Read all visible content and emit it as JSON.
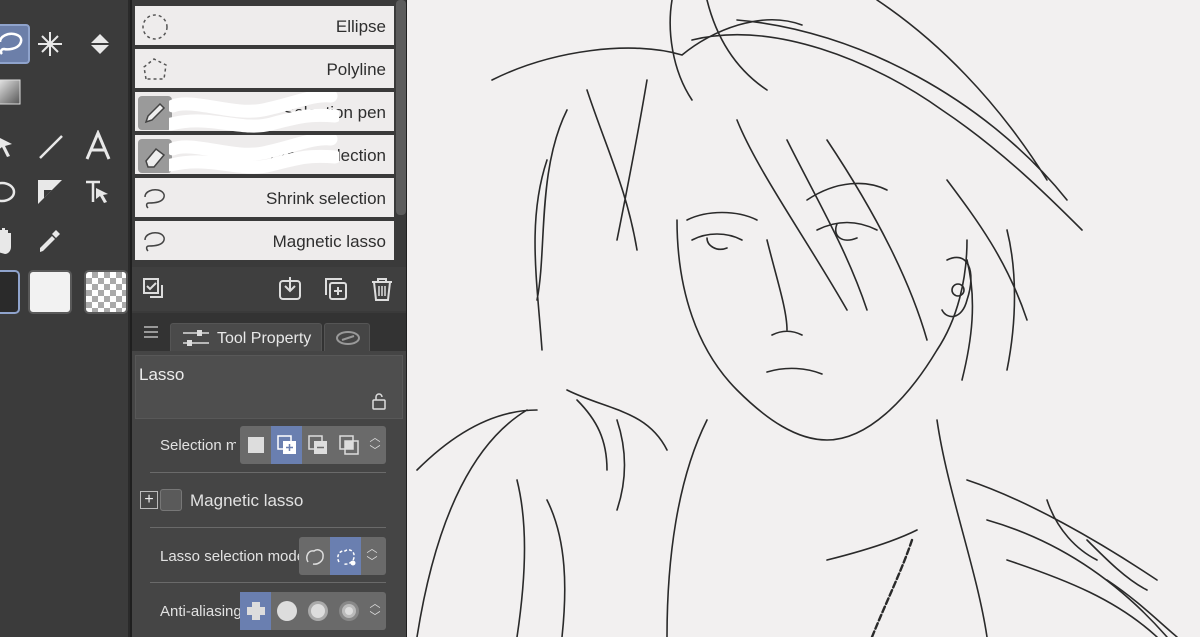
{
  "toolbox": {
    "tools": [
      "selection-lasso",
      "auto-select",
      "fill",
      "gradient",
      "operation",
      "line",
      "text",
      "ellipse-figure",
      "ruler",
      "object",
      "hand",
      "eyedropper"
    ],
    "active_tool": "selection-lasso",
    "colors": {
      "main": "#2a2a2a",
      "sub": "#f2f2f2",
      "transparent": "checker"
    }
  },
  "subtool": {
    "items": [
      {
        "label": "Ellipse",
        "icon": "dashed-circle-icon"
      },
      {
        "label": "Polyline",
        "icon": "dashed-polygon-icon"
      },
      {
        "label": "Selection pen",
        "icon": "pen-icon"
      },
      {
        "label": "Erase selection",
        "icon": "eraser-icon"
      },
      {
        "label": "Shrink selection",
        "icon": "lasso-icon"
      },
      {
        "label": "Magnetic lasso",
        "icon": "lasso-icon"
      }
    ],
    "footer_icons": [
      "subtool-settings-icon",
      "import-icon",
      "duplicate-icon",
      "trash-icon"
    ]
  },
  "property": {
    "tab_label": "Tool Property",
    "tool_name": "Lasso",
    "selection_mode_label": "Selection mo",
    "magnetic_lasso_label": "Magnetic lasso",
    "lasso_mode_label": "Lasso selection mode",
    "anti_aliasing_label": "Anti-aliasing"
  },
  "colors": {
    "accent": "#6a7fb0",
    "panel": "#454545",
    "canvas": "#f2f0f0"
  }
}
